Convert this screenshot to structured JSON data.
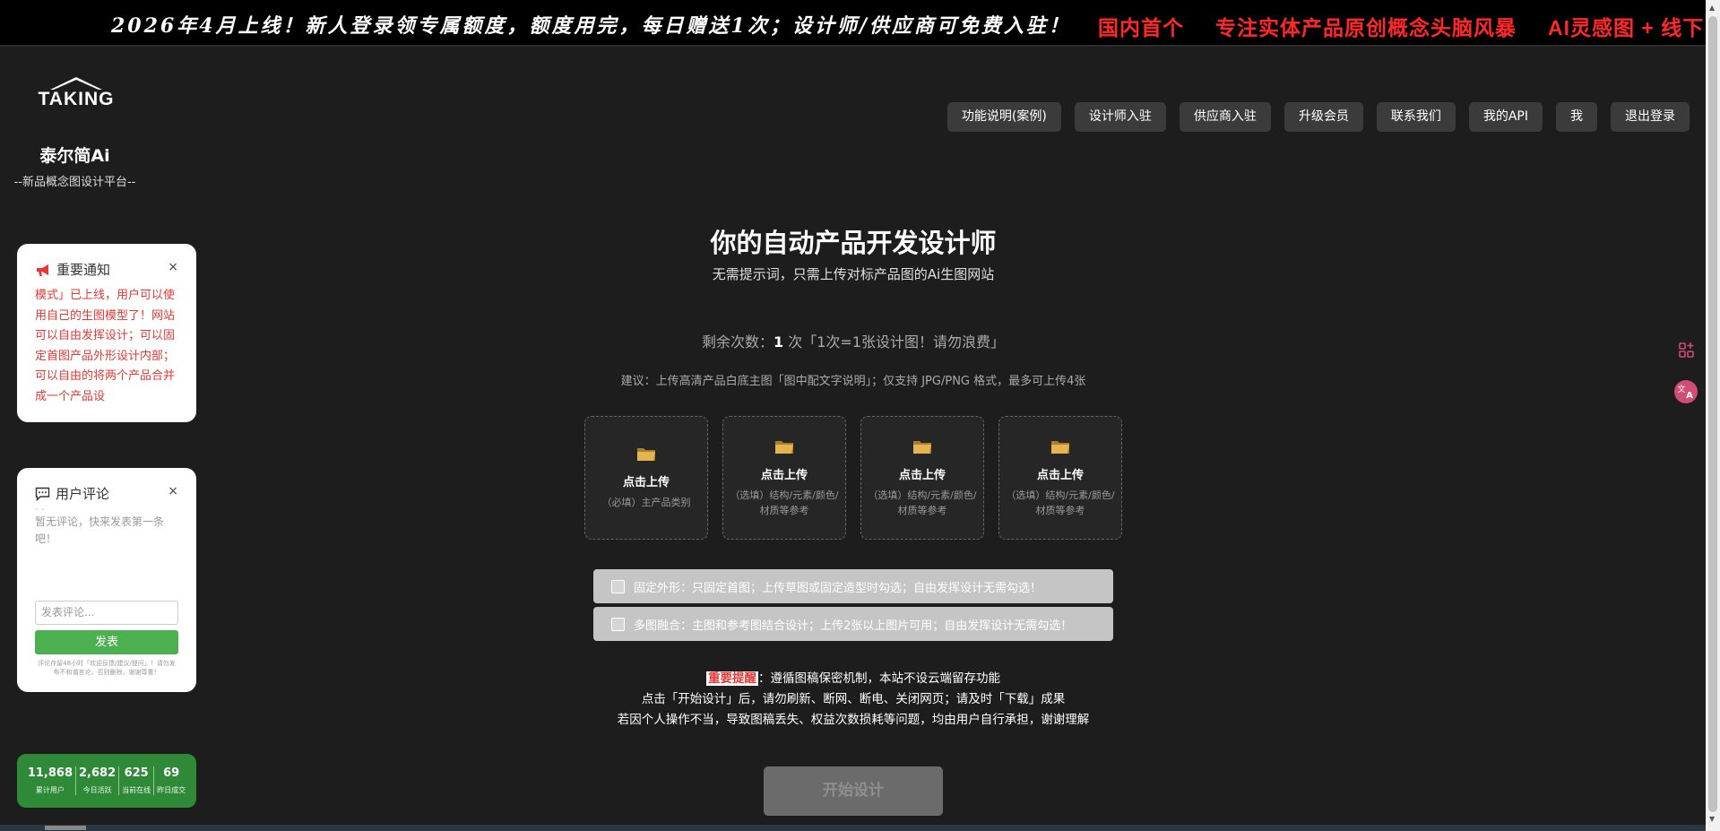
{
  "banner": {
    "announcement": "2026年4月上线！新人登录领专属额度，额度用完，每日赠送1次；设计师/供应商可免费入驻！",
    "tag1": "国内首个",
    "tag2": "专注实体产品原创概念头脑风暴",
    "tag3": "AI灵感图 + 线下"
  },
  "brand": {
    "logo_text": "TAKING",
    "name": "泰尔简Ai",
    "subtitle": "--新品概念图设计平台--"
  },
  "nav": {
    "items": [
      "功能说明(案例)",
      "设计师入驻",
      "供应商入驻",
      "升级会员",
      "联系我们",
      "我的API",
      "我",
      "退出登录"
    ]
  },
  "notice": {
    "title": "重要通知",
    "close": "×",
    "body": "模式」已上线，用户可以使用自己的生图模型了！网站可以自由发挥设计；可以固定首图产品外形设计内部；可以自由的将两个产品合并成一个产品设"
  },
  "review": {
    "title": "用户评论",
    "close": "×",
    "dash": "- -",
    "empty_text": "暂无评论，快来发表第一条吧！",
    "input_placeholder": "发表评论...",
    "submit_label": "发表",
    "tip": "评论存留48小时「欢迎反馈/建议/提问」！请勿发布不和谐言论，否则删除，谢谢尊重！"
  },
  "stats": [
    {
      "value": "11,868",
      "label": "累计用户"
    },
    {
      "value": "2,682",
      "label": "今日活跃"
    },
    {
      "value": "625",
      "label": "当前在线"
    },
    {
      "value": "69",
      "label": "昨日成交"
    }
  ],
  "main": {
    "title": "你的自动产品开发设计师",
    "subtitle": "无需提示词，只需上传对标产品图的Ai生图网站",
    "remaining_prefix": "剩余次数：",
    "remaining_count": "1",
    "remaining_suffix": " 次「1次=1张设计图！请勿浪费」",
    "hint": "建议：上传高清产品白底主图「图中配文字说明」；仅支持 JPG/PNG 格式，最多可上传4张",
    "uploads": [
      {
        "label": "点击上传",
        "desc": "（必填）主产品类别"
      },
      {
        "label": "点击上传",
        "desc": "（选填）结构/元素/颜色/材质等参考"
      },
      {
        "label": "点击上传",
        "desc": "（选填）结构/元素/颜色/材质等参考"
      },
      {
        "label": "点击上传",
        "desc": "（选填）结构/元素/颜色/材质等参考"
      }
    ],
    "option1": "固定外形：只固定首图；上传草图或固定造型时勾选；自由发挥设计无需勾选！",
    "option2": "多图融合：主图和参考图结合设计；上传2张以上图片可用；自由发挥设计无需勾选！",
    "warn_label": "重要提醒",
    "warn_line1": "：遵循图稿保密机制，本站不设云端留存功能",
    "warn_line2": "点击「开始设计」后，请勿刷新、断网、断电、关闭网页；请及时「下载」成果",
    "warn_line3": "若因个人操作不当，导致图稿丢失、权益次数损耗等问题，均由用户自行承担，谢谢理解",
    "start_label": "开始设计"
  },
  "colors": {
    "background": "#1d1d1d",
    "accent_red": "#ff2727",
    "stats_green": "#2f8a38",
    "submit_green": "#4caf50"
  }
}
